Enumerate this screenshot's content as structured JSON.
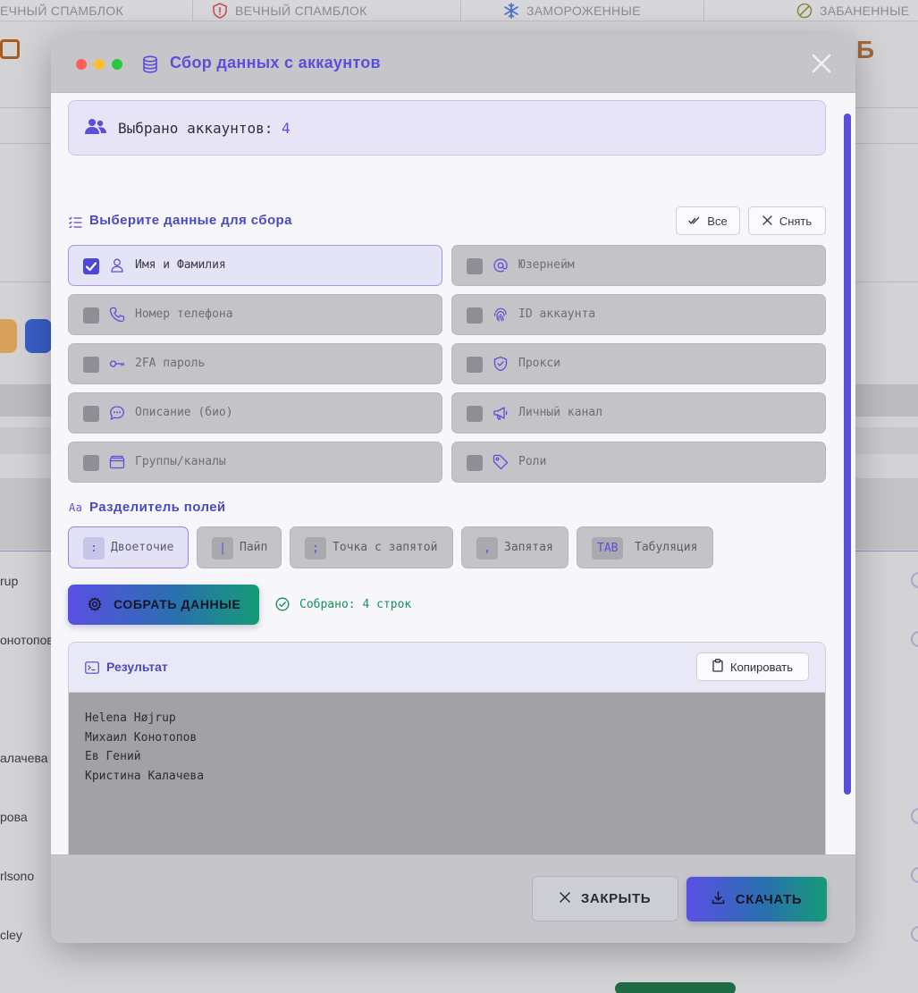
{
  "background": {
    "tabs": [
      {
        "label": "ЕЧНЫЙ СПАМБЛОК",
        "icon": "none"
      },
      {
        "label": "ВЕЧНЫЙ СПАМБЛОК",
        "icon": "alert-shield-icon"
      },
      {
        "label": "ЗАМОРОЖЕННЫЕ",
        "icon": "snowflake-icon"
      },
      {
        "label": "ЗАБАНЕННЫЕ",
        "icon": "ban-icon"
      }
    ],
    "row_texts": [
      "rup",
      "онотопов",
      "алачева",
      "рова",
      "rlsono",
      "cley"
    ]
  },
  "modal": {
    "title": "Сбор данных с аккаунтов",
    "selected": {
      "label": "Выбрано аккаунтов:",
      "count": "4"
    },
    "fields_section": {
      "title": "Выберите данные для сбора",
      "all_label": "Все",
      "clear_label": "Снять"
    },
    "options": [
      {
        "label": "Имя и Фамилия",
        "icon": "user-icon",
        "checked": true
      },
      {
        "label": "Юзернейм",
        "icon": "at-icon",
        "checked": false
      },
      {
        "label": "Номер телефона",
        "icon": "phone-icon",
        "checked": false
      },
      {
        "label": "ID аккаунта",
        "icon": "fingerprint-icon",
        "checked": false
      },
      {
        "label": "2FA пароль",
        "icon": "key-icon",
        "checked": false
      },
      {
        "label": "Прокси",
        "icon": "shield-icon",
        "checked": false
      },
      {
        "label": "Описание (био)",
        "icon": "chat-icon",
        "checked": false
      },
      {
        "label": "Личный канал",
        "icon": "megaphone-icon",
        "checked": false
      },
      {
        "label": "Группы/каналы",
        "icon": "folder-icon",
        "checked": false
      },
      {
        "label": "Роли",
        "icon": "tag-icon",
        "checked": false
      }
    ],
    "separator_section": {
      "title": "Разделитель полей",
      "icon_text": "Aa",
      "options": [
        {
          "symbol": ":",
          "label": "Двоеточие",
          "active": true
        },
        {
          "symbol": "|",
          "label": "Пайп",
          "active": false
        },
        {
          "symbol": ";",
          "label": "Точка с запятой",
          "active": false
        },
        {
          "symbol": ",",
          "label": "Запятая",
          "active": false
        },
        {
          "symbol": "TAB",
          "label": "Табуляция",
          "active": false
        }
      ]
    },
    "collect_button": "СОБРАТЬ ДАННЫЕ",
    "collected_status": "Собрано: 4 строк",
    "result": {
      "title": "Результат",
      "copy_label": "Копировать",
      "lines": [
        "Helena Højrup",
        "Михаил Конотопов",
        "Ев Гений",
        "Кристина Калачева"
      ]
    },
    "footer": {
      "close_label": "ЗАКРЫТЬ",
      "download_label": "СКАЧАТЬ"
    },
    "colors": {
      "accent": "#5a4fd8",
      "success": "#16915e",
      "gradient_end": "#159b77"
    }
  }
}
